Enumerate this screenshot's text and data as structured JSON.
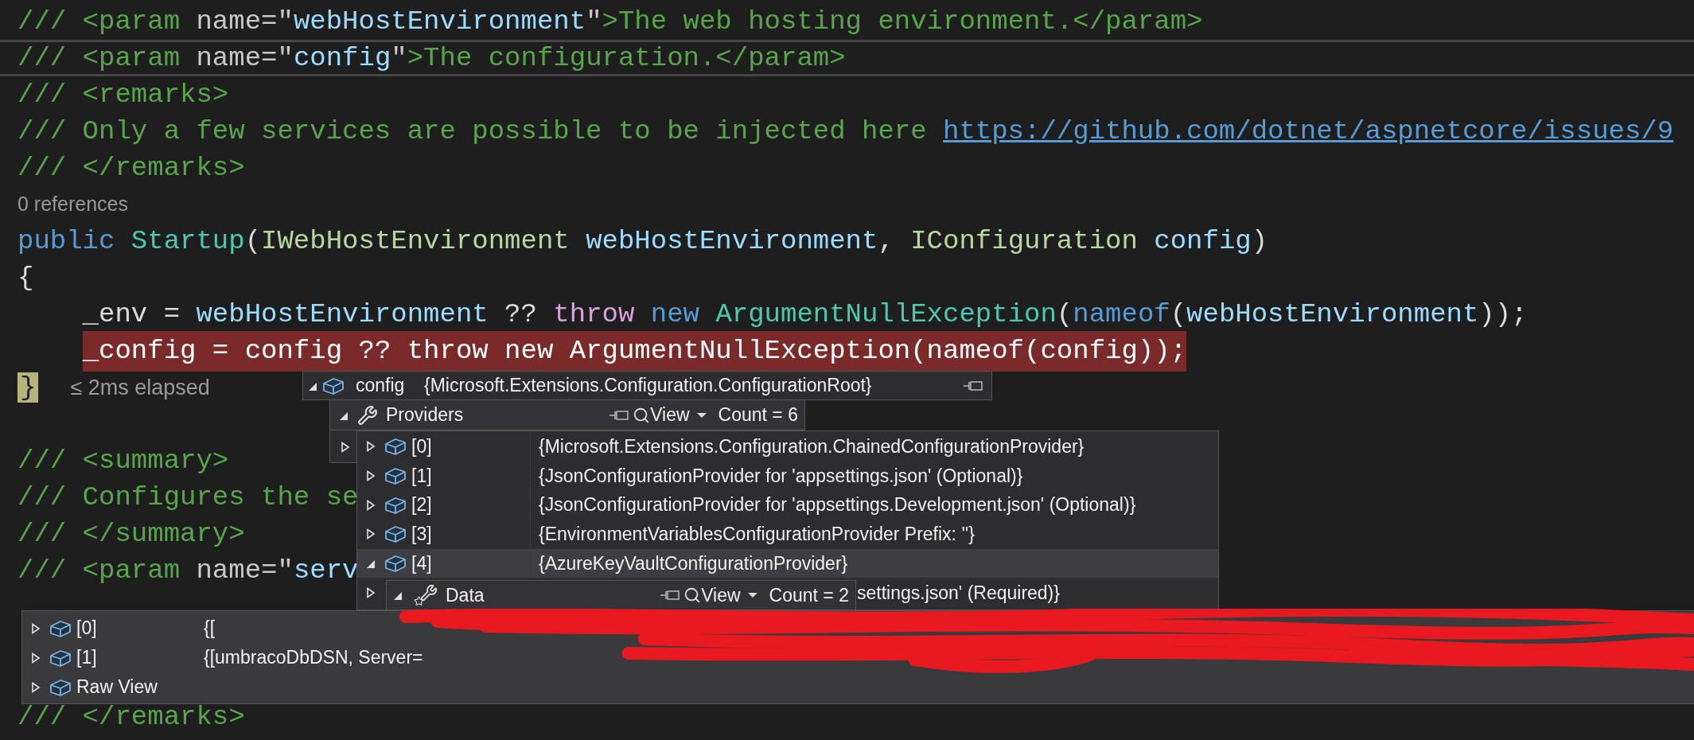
{
  "editor": {
    "lines": [
      {
        "kind": "code",
        "current": false,
        "highlighted": false,
        "tokens": [
          {
            "text": "/// <param ",
            "kind": "comment"
          },
          {
            "text": "name",
            "kind": "attr"
          },
          {
            "text": "=\"",
            "kind": "punct"
          },
          {
            "text": "webHostEnvironment",
            "kind": "param"
          },
          {
            "text": "\"",
            "kind": "punct"
          },
          {
            "text": ">The web hosting environment.</param>",
            "kind": "comment"
          }
        ]
      },
      {
        "kind": "code",
        "current": true,
        "highlighted": false,
        "tokens": [
          {
            "text": "/// <param ",
            "kind": "comment"
          },
          {
            "text": "name",
            "kind": "attr"
          },
          {
            "text": "=\"",
            "kind": "punct"
          },
          {
            "text": "config",
            "kind": "param"
          },
          {
            "text": "\"",
            "kind": "punct"
          },
          {
            "text": ">The configuration.</param>",
            "kind": "comment"
          }
        ]
      },
      {
        "kind": "code",
        "current": false,
        "highlighted": false,
        "tokens": [
          {
            "text": "/// <remarks>",
            "kind": "comment"
          }
        ]
      },
      {
        "kind": "code",
        "current": false,
        "highlighted": false,
        "tokens": [
          {
            "text": "/// Only a few services are possible to be injected here ",
            "kind": "comment"
          },
          {
            "text": "https://github.com/dotnet/aspnetcore/issues/9",
            "kind": "link"
          }
        ]
      },
      {
        "kind": "code",
        "current": false,
        "highlighted": false,
        "tokens": [
          {
            "text": "/// </remarks>",
            "kind": "comment"
          }
        ]
      },
      {
        "kind": "codelens",
        "text": "0 references"
      },
      {
        "kind": "code",
        "current": false,
        "highlighted": false,
        "tokens": [
          {
            "text": "public ",
            "kind": "keyword"
          },
          {
            "text": "Startup",
            "kind": "type"
          },
          {
            "text": "(",
            "kind": "plain"
          },
          {
            "text": "IWebHostEnvironment ",
            "kind": "interface"
          },
          {
            "text": "webHostEnvironment",
            "kind": "param"
          },
          {
            "text": ", ",
            "kind": "plain"
          },
          {
            "text": "IConfiguration ",
            "kind": "interface"
          },
          {
            "text": "config",
            "kind": "param"
          },
          {
            "text": ")",
            "kind": "plain"
          }
        ]
      },
      {
        "kind": "code",
        "current": false,
        "highlighted": false,
        "tokens": [
          {
            "text": "{",
            "kind": "plain"
          }
        ]
      },
      {
        "kind": "code",
        "current": false,
        "highlighted": false,
        "tokens": [
          {
            "text": "    _env = ",
            "kind": "plain"
          },
          {
            "text": "webHostEnvironment",
            "kind": "param"
          },
          {
            "text": " ?? ",
            "kind": "plain"
          },
          {
            "text": "throw ",
            "kind": "control"
          },
          {
            "text": "new ",
            "kind": "keyword"
          },
          {
            "text": "ArgumentNullException",
            "kind": "type"
          },
          {
            "text": "(",
            "kind": "plain"
          },
          {
            "text": "nameof",
            "kind": "keyword"
          },
          {
            "text": "(",
            "kind": "plain"
          },
          {
            "text": "webHostEnvironment",
            "kind": "param"
          },
          {
            "text": "));",
            "kind": "plain"
          }
        ]
      },
      {
        "kind": "code",
        "current": false,
        "highlighted": true,
        "tokens": [
          {
            "text": "    _config = config ?? throw new ArgumentNullException(nameof(config));",
            "kind": "plain"
          }
        ]
      },
      {
        "kind": "code",
        "current": false,
        "highlighted": false,
        "tokens": [
          {
            "text": "}",
            "kind": "brace_match"
          }
        ],
        "perf_tip": "≤ 2ms elapsed"
      },
      {
        "kind": "blank"
      },
      {
        "kind": "code",
        "current": false,
        "highlighted": false,
        "tokens": [
          {
            "text": "/// <summary>",
            "kind": "comment"
          }
        ]
      },
      {
        "kind": "code",
        "current": false,
        "highlighted": false,
        "tokens": [
          {
            "text": "/// Configures the se",
            "kind": "comment"
          }
        ]
      },
      {
        "kind": "code",
        "current": false,
        "highlighted": false,
        "tokens": [
          {
            "text": "/// </summary>",
            "kind": "comment"
          }
        ]
      },
      {
        "kind": "code",
        "current": false,
        "highlighted": false,
        "tokens": [
          {
            "text": "/// <param ",
            "kind": "comment"
          },
          {
            "text": "name",
            "kind": "attr"
          },
          {
            "text": "=\"",
            "kind": "punct"
          },
          {
            "text": "serv",
            "kind": "param"
          }
        ]
      },
      {
        "kind": "blank"
      },
      {
        "kind": "blank"
      },
      {
        "kind": "blank"
      },
      {
        "kind": "code",
        "current": false,
        "highlighted": false,
        "tokens": [
          {
            "text": "/// </remarks>",
            "kind": "comment"
          }
        ]
      }
    ]
  },
  "datatip": {
    "root": {
      "name": "config",
      "value": "{Microsoft.Extensions.Configuration.ConfigurationRoot}",
      "expanded": true
    },
    "providers": {
      "name": "Providers",
      "view": "View",
      "count": "Count = 6",
      "expanded": true
    },
    "next_child": {
      "expanded": false
    },
    "provider_items": [
      {
        "name": "[0]",
        "value": "{Microsoft.Extensions.Configuration.ChainedConfigurationProvider}",
        "expanded": false,
        "selected": false
      },
      {
        "name": "[1]",
        "value": "{JsonConfigurationProvider for 'appsettings.json' (Optional)}",
        "expanded": false,
        "selected": false
      },
      {
        "name": "[2]",
        "value": "{JsonConfigurationProvider for 'appsettings.Development.json' (Optional)}",
        "expanded": false,
        "selected": false
      },
      {
        "name": "[3]",
        "value": "{EnvironmentVariablesConfigurationProvider Prefix: ''}",
        "expanded": false,
        "selected": false
      },
      {
        "name": "[4]",
        "value": "{AzureKeyVaultConfigurationProvider}",
        "expanded": true,
        "selected": true
      },
      {
        "value": "settings.json' (Required)}",
        "expanded": false,
        "selected": false
      }
    ],
    "data": {
      "name": "Data",
      "view": "View",
      "count": "Count = 2",
      "expanded": true
    },
    "data_items": [
      {
        "name": "[0]",
        "value": "{[",
        "expanded": false
      },
      {
        "name": "[1]",
        "value": "{[umbracoDbDSN, Server=",
        "expanded": false
      },
      {
        "name": "Raw View",
        "expanded": false
      }
    ]
  }
}
